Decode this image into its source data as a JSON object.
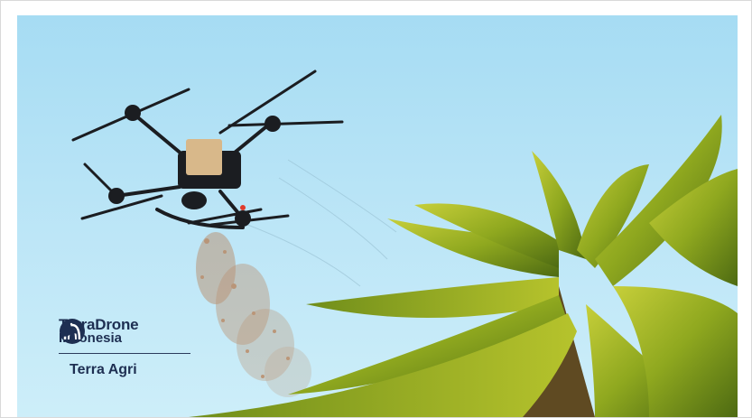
{
  "brand": {
    "terradrone_line1": "TerraDrone",
    "terradrone_line2": "Indonesia",
    "terra_agri": "Terra Agri",
    "terradrone_icon": "terradrone-arch-logo",
    "terra_agri_icon": "bird-leaf-logo",
    "logo_color": "#1e2f52"
  },
  "scene": {
    "sky_color": "#b3e1f5",
    "palm_color": "#8aa21e",
    "spray_color": "#b77a4e",
    "drone_color": "#1b1d21",
    "payload_color": "#d8b88a"
  }
}
